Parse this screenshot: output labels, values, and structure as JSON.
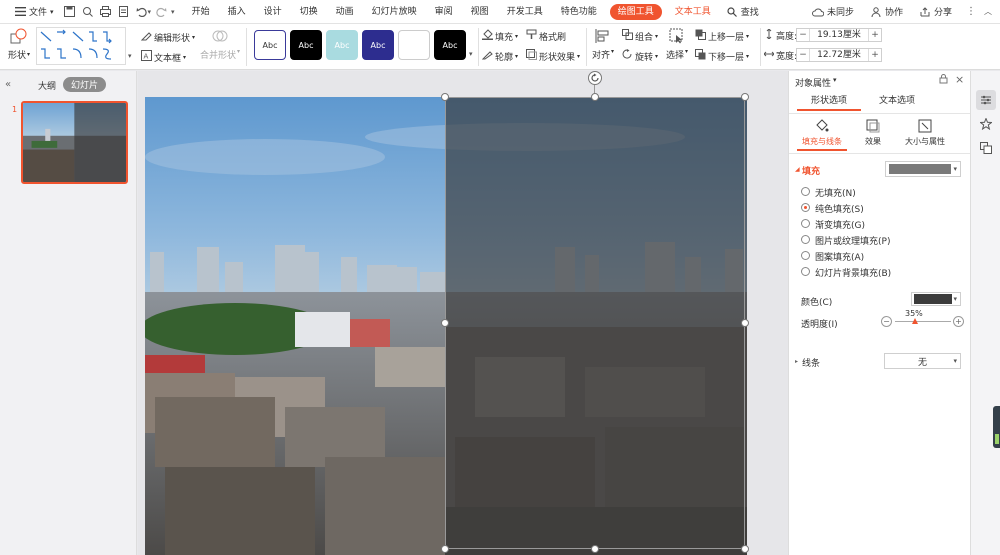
{
  "menubar": {
    "file_label": "文件",
    "tabs": [
      "开始",
      "插入",
      "设计",
      "切换",
      "动画",
      "幻灯片放映",
      "审阅",
      "视图",
      "开发工具",
      "特色功能"
    ],
    "active_tab": "绘图工具",
    "text_tool_tab": "文本工具",
    "search_label": "查找",
    "sync_label": "未同步",
    "collab_label": "协作",
    "share_label": "分享"
  },
  "ribbon": {
    "shape_label": "形状",
    "edit_shape_label": "编辑形状",
    "textbox_label": "文本框",
    "merge_shape_label": "合并形状",
    "style_swatches": [
      {
        "label": "Abc",
        "bg": "#ffffff",
        "fg": "#333333",
        "border": "#3a3a9a"
      },
      {
        "label": "Abc",
        "bg": "#000000",
        "fg": "#ffffff",
        "border": "#000000"
      },
      {
        "label": "Abc",
        "bg": "#a9dbe0",
        "fg": "#ffffff",
        "border": "#a9dbe0"
      },
      {
        "label": "Abc",
        "bg": "#2d2d8f",
        "fg": "#ffffff",
        "border": "#2d2d8f"
      },
      {
        "label": "",
        "bg": "#ffffff",
        "fg": "#333333",
        "border": "#cccccc"
      },
      {
        "label": "Abc",
        "bg": "#000000",
        "fg": "#ffffff",
        "border": "#000000"
      }
    ],
    "fill_label": "填充",
    "format_brush_label": "格式刷",
    "outline_label": "轮廓",
    "shape_effect_label": "形状效果",
    "align_label": "对齐",
    "group_label": "组合",
    "rotate_label": "旋转",
    "select_label": "选择",
    "bring_forward_label": "上移一层",
    "send_backward_label": "下移一层",
    "height_label": "高度:",
    "height_value": "19.13厘米",
    "width_label": "宽度:",
    "width_value": "12.72厘米"
  },
  "leftpanel": {
    "outline_tab": "大纲",
    "slides_tab": "幻灯片",
    "slide_number": "1"
  },
  "rightpanel": {
    "title": "对象属性",
    "tabs": [
      "形状选项",
      "文本选项"
    ],
    "subtabs": [
      "填充与线条",
      "效果",
      "大小与属性"
    ],
    "fill_section": "填充",
    "fill_options": [
      "无填充(N)",
      "纯色填充(S)",
      "渐变填充(G)",
      "图片或纹理填充(P)",
      "图案填充(A)",
      "幻灯片背景填充(B)"
    ],
    "selected_fill_index": 1,
    "color_label": "颜色(C)",
    "transparency_label": "透明度(I)",
    "transparency_value": "35%",
    "transparency_fraction": 0.35,
    "line_section": "线条",
    "line_value": "无"
  },
  "colors": {
    "accent": "#f0542f",
    "fill_swatch": "#7a7a7a",
    "color_swatch": "#3c3c3c"
  }
}
